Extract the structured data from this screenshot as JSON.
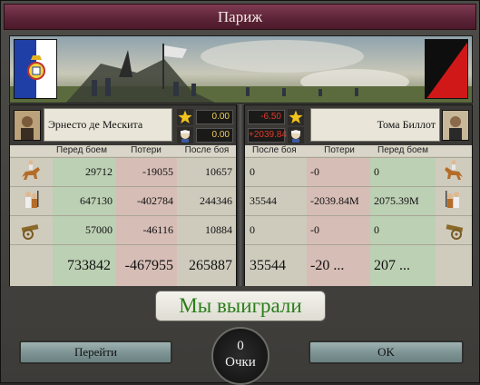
{
  "window": {
    "title": "Париж"
  },
  "left": {
    "commander": "Эрнесто де Мескита",
    "stats": {
      "star": "0.00",
      "wound": "0.00"
    },
    "headers": {
      "before": "Перед боем",
      "losses": "Потери",
      "after": "После боя"
    },
    "rows": [
      {
        "unit": "cavalry-icon",
        "before": "29712",
        "losses": "-19055",
        "after": "10657"
      },
      {
        "unit": "infantry-icon",
        "before": "647130",
        "losses": "-402784",
        "after": "244346"
      },
      {
        "unit": "artillery-icon",
        "before": "57000",
        "losses": "-46116",
        "after": "10884"
      }
    ],
    "totals": {
      "before": "733842",
      "losses": "-467955",
      "after": "265887"
    }
  },
  "right": {
    "commander": "Тома Биллот",
    "stats": {
      "star": "-6.50",
      "wound": "+2039.84"
    },
    "headers": {
      "after": "После боя",
      "losses": "Потери",
      "before": "Перед боем"
    },
    "rows": [
      {
        "unit": "cavalry-icon",
        "after": "0",
        "losses": "-0",
        "before": "0"
      },
      {
        "unit": "infantry-icon",
        "after": "35544",
        "losses": "-2039.84M",
        "before": "2075.39M"
      },
      {
        "unit": "artillery-icon",
        "after": "0",
        "losses": "-0",
        "before": "0"
      }
    ],
    "totals": {
      "after": "35544",
      "losses": "-20 ...",
      "before": "207 ..."
    }
  },
  "result": {
    "text": "Мы выиграли"
  },
  "score": {
    "value": "0",
    "label": "Очки"
  },
  "buttons": {
    "goto": "Перейти",
    "ok": "OK"
  },
  "colors": {
    "title": "#5c2337",
    "victory": "#2a7d1a",
    "positive": "#f0d060",
    "negative": "#e03a2a"
  }
}
